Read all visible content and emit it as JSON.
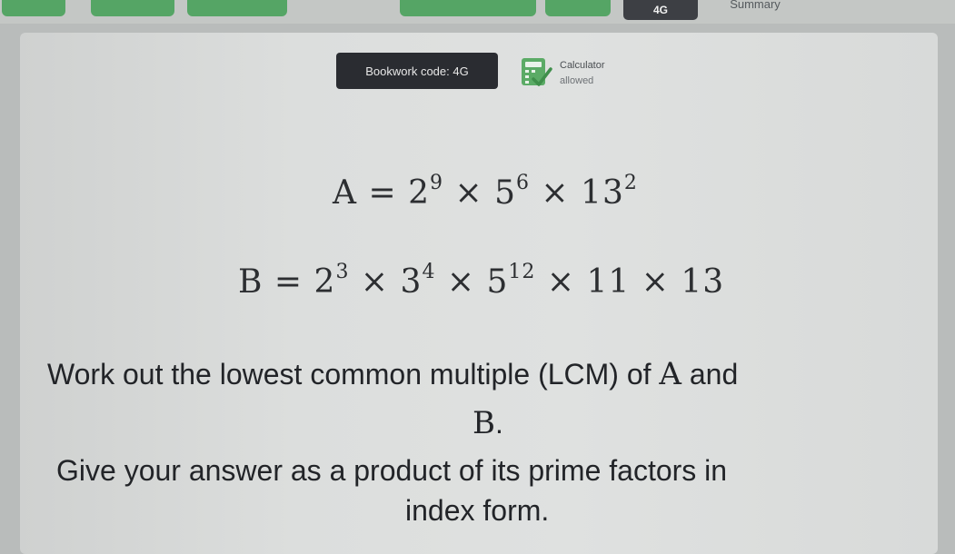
{
  "nav": {
    "tabs": [
      {
        "label": ""
      },
      {
        "label": ""
      },
      {
        "label": ""
      },
      {
        "label": ""
      },
      {
        "label": ""
      }
    ],
    "current_tab": "4G",
    "summary_tab": "Summary"
  },
  "question": {
    "bookwork_label": "Bookwork code: 4G",
    "calculator_line1": "Calculator",
    "calculator_line2": "allowed",
    "eq_a": {
      "lhs": "A",
      "op": "=",
      "terms": [
        {
          "base": "2",
          "exp": "9"
        },
        {
          "base": "5",
          "exp": "6"
        },
        {
          "base": "13",
          "exp": "2"
        }
      ]
    },
    "eq_b": {
      "lhs": "B",
      "op": "=",
      "terms": [
        {
          "base": "2",
          "exp": "3"
        },
        {
          "base": "3",
          "exp": "4"
        },
        {
          "base": "5",
          "exp": "12"
        },
        {
          "base": "11",
          "exp": ""
        },
        {
          "base": "13",
          "exp": ""
        }
      ]
    },
    "times": "×",
    "instruction_line1": "Work out the lowest common multiple (LCM) of",
    "instruction_var_a": "A",
    "instruction_and": "and",
    "instruction_var_b": "B",
    "instruction_period": ".",
    "answer_line1": "Give your answer as a product of its prime factors in",
    "answer_line2": "index form."
  },
  "colors": {
    "tab_green": "#55a565",
    "tab_dark": "#3d3f44",
    "card_bg": "#dcdedd",
    "bookwork_bg": "#2a2c31",
    "calc_icon_green": "#5bab66"
  },
  "icons": {
    "calculator": "calculator-icon"
  }
}
